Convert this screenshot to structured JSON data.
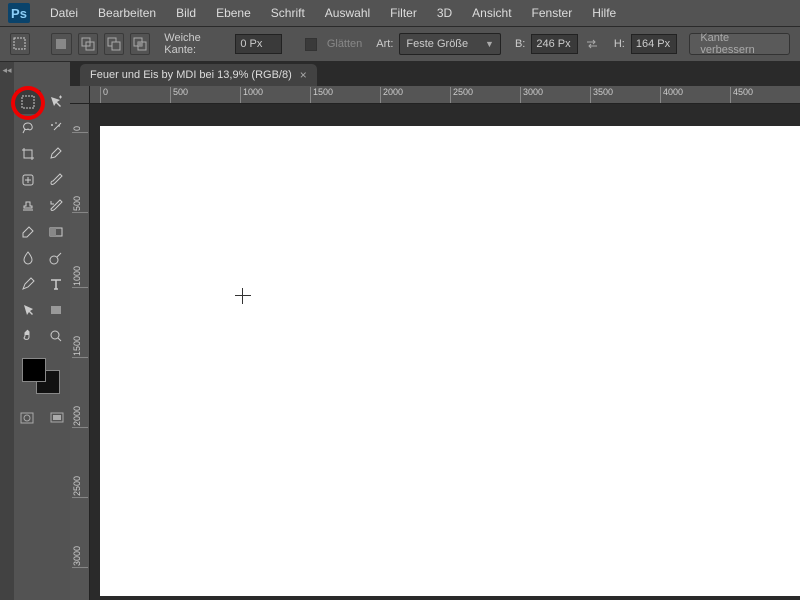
{
  "app": {
    "logo": "Ps"
  },
  "menu": [
    "Datei",
    "Bearbeiten",
    "Bild",
    "Ebene",
    "Schrift",
    "Auswahl",
    "Filter",
    "3D",
    "Ansicht",
    "Fenster",
    "Hilfe"
  ],
  "options": {
    "soft_edge_label": "Weiche Kante:",
    "soft_edge_value": "0 Px",
    "smooth_label": "Glätten",
    "mode_label": "Art:",
    "mode_value": "Feste Größe",
    "width_label": "B:",
    "width_value": "246 Px",
    "height_label": "H:",
    "height_value": "164 Px",
    "refine_label": "Kante verbessern"
  },
  "tab": {
    "title": "Feuer und Eis by MDI bei 13,9% (RGB/8)"
  },
  "ruler_h": [
    {
      "pos": 0,
      "label": "0"
    },
    {
      "pos": 70,
      "label": "500"
    },
    {
      "pos": 140,
      "label": "1000"
    },
    {
      "pos": 210,
      "label": "1500"
    },
    {
      "pos": 280,
      "label": "2000"
    },
    {
      "pos": 350,
      "label": "2500"
    },
    {
      "pos": 420,
      "label": "3000"
    },
    {
      "pos": 490,
      "label": "3500"
    },
    {
      "pos": 560,
      "label": "4000"
    },
    {
      "pos": 630,
      "label": "4500"
    }
  ],
  "ruler_v": [
    {
      "pos": 0,
      "label": "0"
    },
    {
      "pos": 70,
      "label": "500"
    },
    {
      "pos": 140,
      "label": "1000"
    },
    {
      "pos": 210,
      "label": "1500"
    },
    {
      "pos": 280,
      "label": "2000"
    },
    {
      "pos": 350,
      "label": "2500"
    },
    {
      "pos": 420,
      "label": "3000"
    }
  ],
  "tools": [
    {
      "name": "marquee",
      "sel": true
    },
    {
      "name": "move"
    },
    {
      "name": "lasso"
    },
    {
      "name": "magic-wand"
    },
    {
      "name": "crop"
    },
    {
      "name": "eyedropper"
    },
    {
      "name": "healing"
    },
    {
      "name": "brush"
    },
    {
      "name": "stamp"
    },
    {
      "name": "history-brush"
    },
    {
      "name": "eraser"
    },
    {
      "name": "gradient"
    },
    {
      "name": "blur"
    },
    {
      "name": "dodge"
    },
    {
      "name": "pen"
    },
    {
      "name": "type"
    },
    {
      "name": "path-select"
    },
    {
      "name": "rectangle"
    },
    {
      "name": "hand"
    },
    {
      "name": "zoom"
    }
  ]
}
